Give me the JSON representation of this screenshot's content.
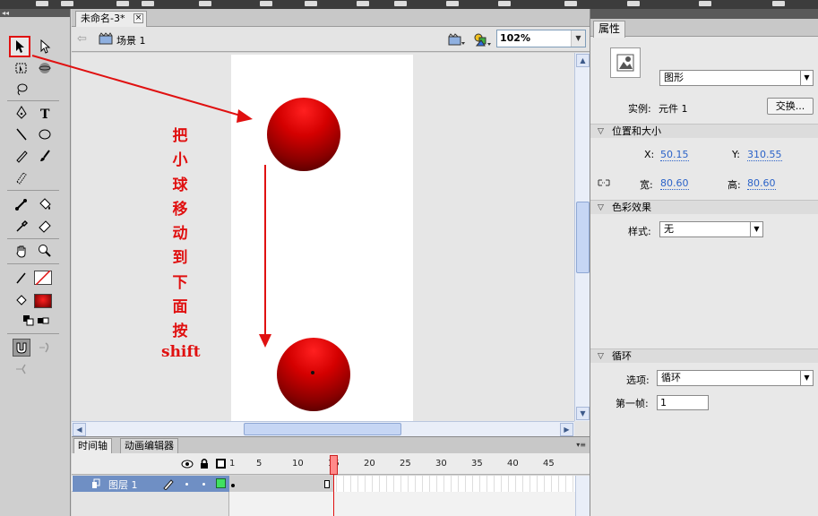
{
  "document": {
    "tab_title": "未命名-3*",
    "tab_close": "×",
    "scene_label": "场景 1",
    "zoom": "102%"
  },
  "annotation": {
    "chars": [
      "把",
      "小",
      "球",
      "移",
      "动",
      "到",
      "下",
      "面",
      "按"
    ],
    "tail": "shift",
    "color": "#e01010"
  },
  "timeline": {
    "tab_timeline": "时间轴",
    "tab_motion_editor": "动画编辑器",
    "frame_numbers": [
      "1",
      "5",
      "10",
      "15",
      "20",
      "25",
      "30",
      "35",
      "40",
      "45"
    ],
    "current_frame": "15",
    "layer_name": "图层 1"
  },
  "properties": {
    "tab": "属性",
    "symbol_type": "图形",
    "instance_label": "实例:",
    "instance_value": "元件 1",
    "swap_button": "交换...",
    "section_position": "位置和大小",
    "x_label": "X:",
    "x_value": "50.15",
    "y_label": "Y:",
    "y_value": "310.55",
    "w_label": "宽:",
    "w_value": "80.60",
    "h_label": "高:",
    "h_value": "80.60",
    "section_color": "色彩效果",
    "style_label": "样式:",
    "style_value": "无",
    "section_loop": "循环",
    "option_label": "选项:",
    "option_value": "循环",
    "first_frame_label": "第一帧:",
    "first_frame_value": "1"
  },
  "colors": {
    "accent_red": "#e01010",
    "ball_red": "#d40000",
    "link_blue": "#2b63c8",
    "layer_selected": "#6f8fc4"
  }
}
